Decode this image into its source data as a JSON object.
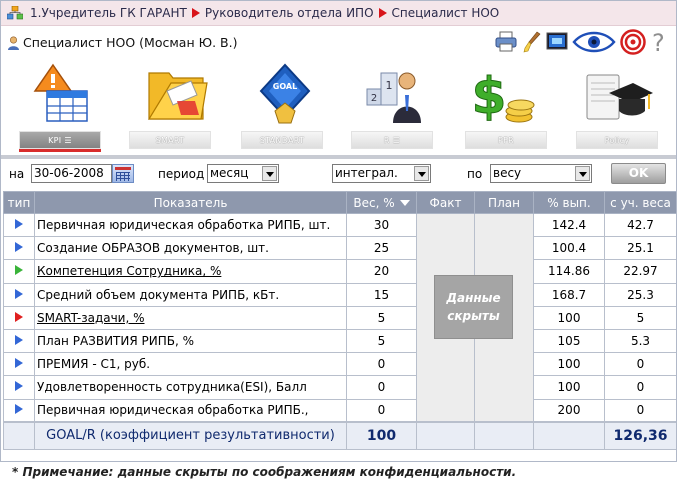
{
  "breadcrumb": [
    "1.Учредитель ГК ГАРАНТ",
    "Руководитель отдела ИПО",
    "Специалист НОО"
  ],
  "user": {
    "label": "Специалист НОО  (Мосман Ю. В.)"
  },
  "toolbar_icons": [
    "printer-icon",
    "brush-icon",
    "monitor-icon",
    "eye-icon",
    "target-icon",
    "help-icon"
  ],
  "modules": [
    {
      "label": "KPI",
      "icon": "kpi-table-icon",
      "active": true
    },
    {
      "label": "SMART",
      "icon": "folder-icon",
      "active": false
    },
    {
      "label": "STANDART",
      "icon": "goal-badge-icon",
      "active": false
    },
    {
      "label": "R",
      "icon": "ranking-person-icon",
      "active": false
    },
    {
      "label": "PFR",
      "icon": "dollar-coins-icon",
      "active": false
    },
    {
      "label": "Policy",
      "icon": "graduation-book-icon",
      "active": false
    }
  ],
  "filters": {
    "date_label": "на",
    "date_value": "30-06-2008",
    "period_label": "период",
    "period_value": "месяц",
    "mode_value": "интеграл.",
    "by_label": "по",
    "by_value": "весу",
    "ok_label": "OK"
  },
  "table": {
    "headers": [
      "тип",
      "Показатель",
      "Вес, %",
      "Факт",
      "План",
      "% вып.",
      "с уч. веса"
    ],
    "rows": [
      {
        "type": "blue",
        "name": "Первичная юридическая обработка РИПБ, шт.",
        "link": false,
        "weight": "30",
        "pct": "142.4",
        "weighted": "42.7"
      },
      {
        "type": "blue",
        "name": "Создание ОБРАЗОВ документов, шт.",
        "link": false,
        "weight": "25",
        "pct": "100.4",
        "weighted": "25.1"
      },
      {
        "type": "green",
        "name": "Компетенция Сотрудника, %",
        "link": true,
        "weight": "20",
        "pct": "114.86",
        "weighted": "22.97"
      },
      {
        "type": "blue",
        "name": "Средний объем документа РИПБ, кБт.",
        "link": false,
        "weight": "15",
        "pct": "168.7",
        "weighted": "25.3"
      },
      {
        "type": "red",
        "name": "SMART-задачи, %",
        "link": true,
        "weight": "5",
        "pct": "100",
        "weighted": "5"
      },
      {
        "type": "blue",
        "name": "План РАЗВИТИЯ РИПБ, %",
        "link": false,
        "weight": "5",
        "pct": "105",
        "weighted": "5.3"
      },
      {
        "type": "blue",
        "name": "ПРЕМИЯ - С1, руб.",
        "link": false,
        "weight": "0",
        "pct": "100",
        "weighted": "0"
      },
      {
        "type": "blue",
        "name": "Удовлетворенность сотрудника(ESI), Балл",
        "link": false,
        "weight": "0",
        "pct": "100",
        "weighted": "0"
      },
      {
        "type": "blue",
        "name": "Первичная юридическая обработка РИПБ.,",
        "link": false,
        "weight": "0",
        "pct": "200",
        "weighted": "0"
      }
    ],
    "total": {
      "label": "GOAL/R (коэффициент результативности)",
      "weight": "100",
      "weighted": "126,36"
    },
    "hidden_label": "Данные скрыты"
  },
  "footnote": "* Примечание: данные скрыты по соображениям конфиденциальности.",
  "colors": {
    "header": "#8e98ad",
    "breadcrumb_bg": "#f4e6ea",
    "accent_red": "#d82c2c",
    "row_blue": "#3367d6",
    "row_green": "#3ab43a",
    "row_red": "#e02020"
  }
}
